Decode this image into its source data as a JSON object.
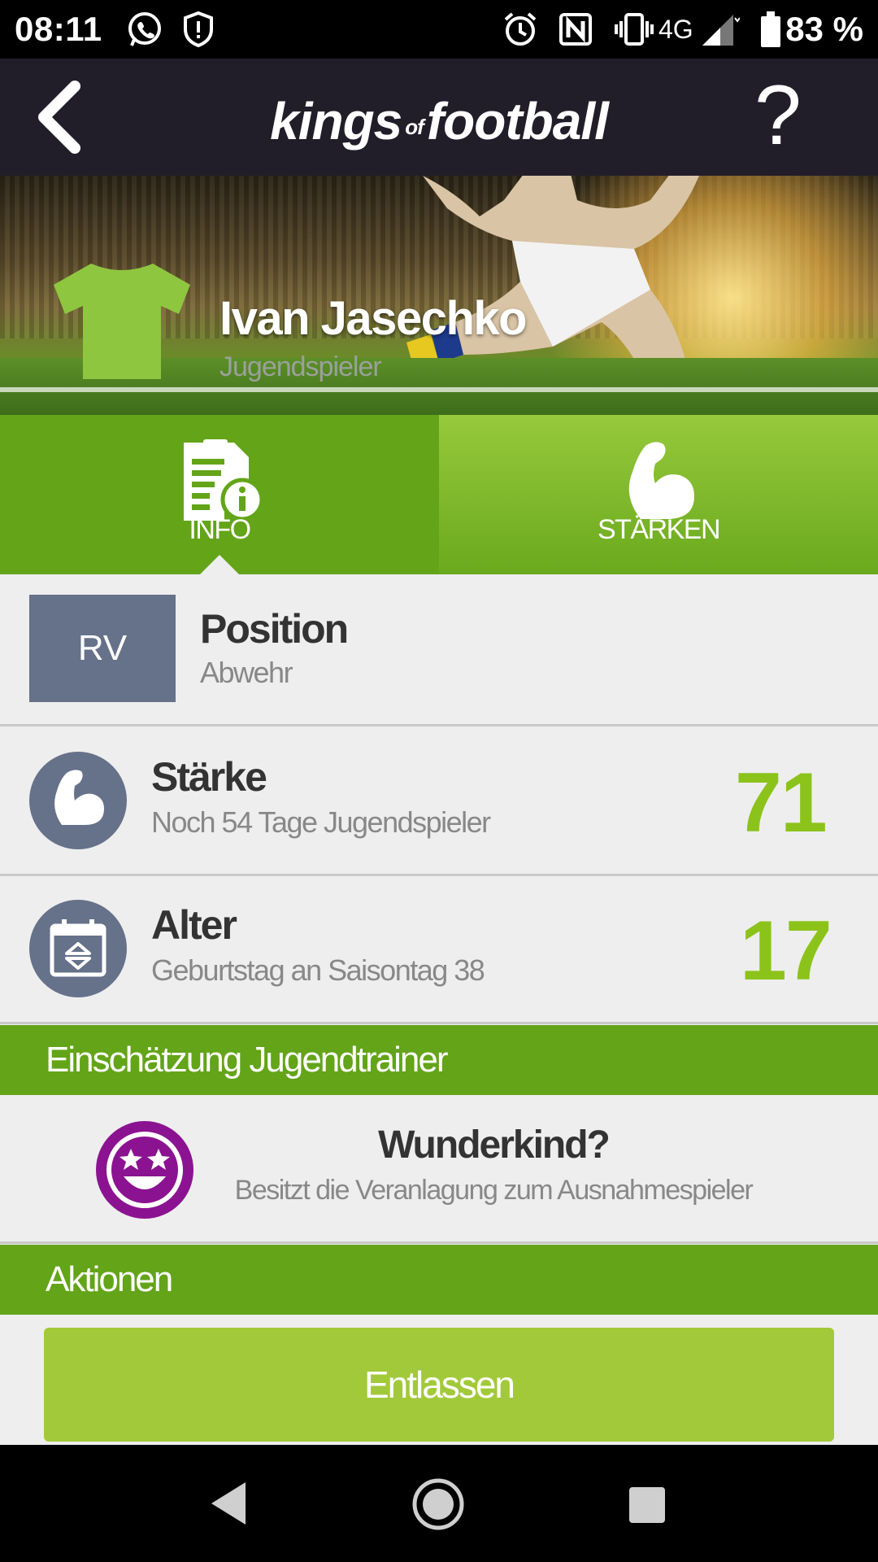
{
  "status_bar": {
    "time": "08:11",
    "network": "4G",
    "battery": "83 %",
    "icons": [
      "whatsapp-icon",
      "shield-alert-icon",
      "alarm-icon",
      "nfc-icon",
      "vibrate-icon",
      "signal-icon",
      "battery-icon"
    ]
  },
  "header": {
    "logo_left": "kings",
    "logo_of": "of",
    "logo_right": "football",
    "help_label": "?"
  },
  "player": {
    "name": "Ivan Jasechko",
    "subtitle": "Jugendspieler",
    "shirt_color": "#8ec63f"
  },
  "tabs": [
    {
      "label": "INFO",
      "icon": "clipboard-info-icon",
      "active": true
    },
    {
      "label": "STÄRKEN",
      "icon": "flexed-biceps-icon",
      "active": false
    }
  ],
  "position": {
    "badge": "RV",
    "title": "Position",
    "value": "Abwehr"
  },
  "strength": {
    "title": "Stärke",
    "subtitle": "Noch 54 Tage Jugendspieler",
    "value": "71"
  },
  "age": {
    "title": "Alter",
    "subtitle": "Geburtstag an Saisontag 38",
    "value": "17"
  },
  "assessment": {
    "section_title": "Einschätzung Jugendtrainer",
    "title": "Wunderkind?",
    "subtitle": "Besitzt die Veranlagung zum Ausnahmespieler",
    "icon": "star-eyes-smiley-icon",
    "icon_color": "#8b1391"
  },
  "actions": {
    "section_title": "Aktionen",
    "dismiss_label": "Entlassen"
  },
  "colors": {
    "header_bg": "#221e29",
    "green": "#63a419",
    "value_green": "#8cc31b",
    "button_green": "#a2c93a",
    "badge_gray": "#66718a"
  }
}
